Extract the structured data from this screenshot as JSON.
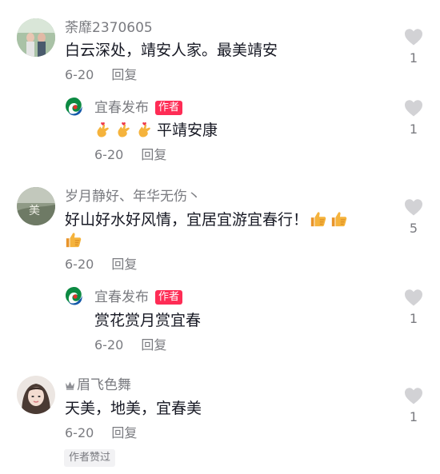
{
  "comments": [
    {
      "username": "荼靡2370605",
      "text": "白云深处，靖安人家。最美靖安",
      "date": "6-20",
      "reply_label": "回复",
      "likes": "1",
      "reply": {
        "username": "宜春发布",
        "author_badge": "作者",
        "emoji_count": 3,
        "emoji_icon": "finger-heart-icon",
        "text": "平靖安康",
        "date": "6-20",
        "reply_label": "回复",
        "likes": "1"
      }
    },
    {
      "username": "岁月静好、年华无伤丶",
      "text_line1": "好山好水好风情，宜居宜游宜春行！",
      "emoji_icon": "thumbs-up-icon",
      "date": "6-20",
      "reply_label": "回复",
      "likes": "5",
      "reply": {
        "username": "宜春发布",
        "author_badge": "作者",
        "text": "赏花赏月赏宜春",
        "date": "6-20",
        "reply_label": "回复",
        "likes": "1"
      }
    },
    {
      "username": "眉飞色舞",
      "username_prefix_icon": "crown-icon",
      "text": "天美，地美，宜春美",
      "date": "6-20",
      "reply_label": "回复",
      "likes": "1",
      "author_liked_tag": "作者赞过"
    }
  ],
  "colors": {
    "author_badge": "#fe2c55",
    "secondary_text": "#7a7b80",
    "like_icon": "#cdcdd0"
  }
}
